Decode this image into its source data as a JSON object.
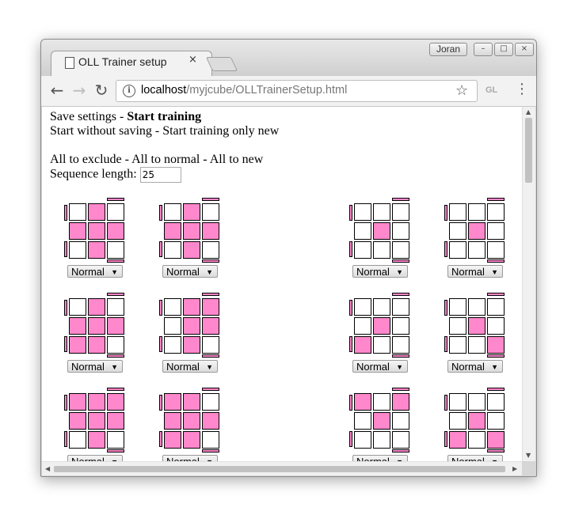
{
  "browser": {
    "tab_title": "OLL Trainer setup",
    "tab_close": "×",
    "user_name": "Joran",
    "window_buttons": [
      "–",
      "□",
      "×"
    ],
    "url_host": "localhost",
    "url_path": "/myjcube/OLLTrainerSetup.html",
    "extension_label": "GL",
    "menu_glyph": "⋮"
  },
  "page": {
    "save_settings": "Save settings - ",
    "start_training": "Start training",
    "start_without_saving": "Start without saving - Start training only new",
    "all_options": "All to exclude - All to normal - All to new",
    "sequence_length_label": "Sequence length:",
    "sequence_length_value": "25"
  },
  "cases": [
    {
      "grid": [
        0,
        1,
        0,
        1,
        1,
        1,
        0,
        1,
        0
      ],
      "sel": "Normal"
    },
    {
      "grid": [
        0,
        1,
        0,
        1,
        1,
        1,
        0,
        1,
        0
      ],
      "sel": "Normal"
    },
    {
      "grid": [
        0,
        0,
        0,
        0,
        1,
        0,
        0,
        0,
        0
      ],
      "sel": "Normal"
    },
    {
      "grid": [
        0,
        0,
        0,
        0,
        1,
        0,
        0,
        0,
        0
      ],
      "sel": "Normal"
    },
    {
      "grid": [
        0,
        1,
        0,
        1,
        1,
        1,
        1,
        1,
        0
      ],
      "sel": "Normal"
    },
    {
      "grid": [
        0,
        1,
        1,
        0,
        1,
        1,
        0,
        1,
        0
      ],
      "sel": "Normal"
    },
    {
      "grid": [
        0,
        0,
        0,
        0,
        1,
        0,
        1,
        0,
        0
      ],
      "sel": "Normal"
    },
    {
      "grid": [
        0,
        0,
        0,
        0,
        1,
        0,
        0,
        0,
        1
      ],
      "sel": "Normal"
    },
    {
      "grid": [
        1,
        1,
        1,
        1,
        1,
        1,
        0,
        1,
        0
      ],
      "sel": "Normal"
    },
    {
      "grid": [
        1,
        1,
        0,
        1,
        1,
        1,
        1,
        1,
        0
      ],
      "sel": "Normal"
    },
    {
      "grid": [
        1,
        0,
        1,
        0,
        1,
        0,
        0,
        0,
        0
      ],
      "sel": "Normal"
    },
    {
      "grid": [
        0,
        0,
        0,
        0,
        1,
        0,
        1,
        0,
        1
      ],
      "sel": "Normal"
    }
  ],
  "colors": {
    "sticker": "#ff88cc",
    "empty": "#ffffff"
  }
}
